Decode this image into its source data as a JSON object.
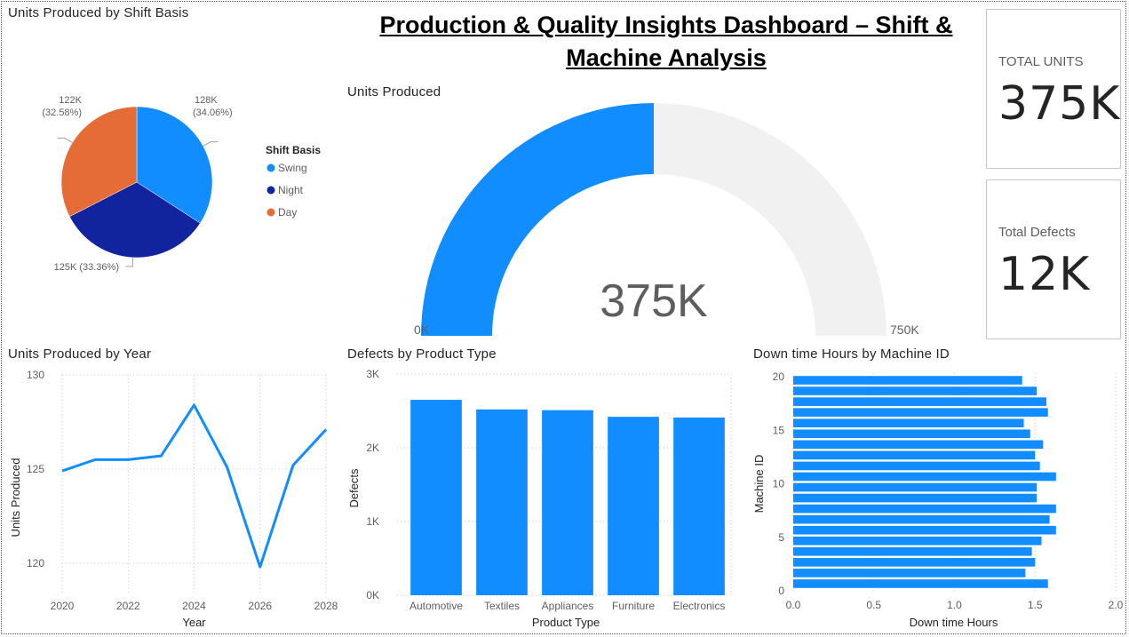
{
  "dashboard": {
    "title": "Production & Quality Insights Dashboard – Shift & Machine Analysis"
  },
  "colors": {
    "primary": "#118DFF",
    "dark_blue": "#12239E",
    "orange": "#E66C37",
    "gauge_track": "#F1F1F1"
  },
  "cards": {
    "total_units": {
      "label": "TOTAL UNITS",
      "value": "375K"
    },
    "total_defects": {
      "label": "Total Defects",
      "value": "12K"
    }
  },
  "visuals": {
    "pie_title": "Units Produced by Shift Basis",
    "gauge_title": "Units Produced",
    "line_title": "Units Produced by Year",
    "bar_title": "Defects by Product Type",
    "hbar_title": "Down time Hours by Machine ID"
  },
  "chart_data": [
    {
      "type": "pie",
      "title": "Units Produced by Shift Basis",
      "legend_title": "Shift Basis",
      "legend_position": "right",
      "slices": [
        {
          "name": "Swing",
          "value": 128,
          "label": "128K",
          "pct": "(34.06%)",
          "color": "#118DFF"
        },
        {
          "name": "Night",
          "value": 125,
          "label": "125K (33.36%)",
          "pct": "",
          "color": "#12239E"
        },
        {
          "name": "Day",
          "value": 122,
          "label": "122K",
          "pct": "(32.58%)",
          "color": "#E66C37"
        }
      ]
    },
    {
      "type": "gauge",
      "title": "Units Produced",
      "value": 375,
      "min": 0,
      "max": 750,
      "value_label": "375K",
      "min_label": "0K",
      "max_label": "750K"
    },
    {
      "type": "line",
      "title": "Units Produced by Year",
      "xlabel": "Year",
      "ylabel": "Units Produced",
      "x": [
        2020,
        2021,
        2022,
        2023,
        2024,
        2025,
        2026,
        2027,
        2028
      ],
      "values": [
        124.9,
        125.5,
        125.5,
        125.7,
        128.4,
        125.1,
        119.8,
        125.2,
        127.1
      ],
      "xlim": [
        2020,
        2028
      ],
      "ylim": [
        118.3,
        130
      ],
      "x_ticks": [
        "2020",
        "2022",
        "2024",
        "2026",
        "2028"
      ],
      "y_ticks": [
        "120",
        "125",
        "130"
      ],
      "grid": true
    },
    {
      "type": "bar",
      "title": "Defects by Product Type",
      "xlabel": "Product Type",
      "ylabel": "Defects",
      "categories": [
        "Automotive",
        "Textiles",
        "Appliances",
        "Furniture",
        "Electronics"
      ],
      "values": [
        2650,
        2520,
        2510,
        2420,
        2410
      ],
      "ylim": [
        0,
        3000
      ],
      "y_ticks": [
        "0K",
        "1K",
        "2K",
        "3K"
      ],
      "grid": true
    },
    {
      "type": "bar",
      "orientation": "horizontal",
      "title": "Down time Hours by Machine ID",
      "xlabel": "Down time Hours",
      "ylabel": "Machine ID",
      "categories": [
        1,
        2,
        3,
        4,
        5,
        6,
        7,
        8,
        9,
        10,
        11,
        12,
        13,
        14,
        15,
        16,
        17,
        18,
        19,
        20
      ],
      "values": [
        1.58,
        1.44,
        1.5,
        1.48,
        1.54,
        1.63,
        1.59,
        1.63,
        1.51,
        1.51,
        1.63,
        1.53,
        1.5,
        1.55,
        1.47,
        1.43,
        1.58,
        1.57,
        1.51,
        1.42
      ],
      "xlim": [
        0,
        2
      ],
      "ylim": [
        0,
        20
      ],
      "x_ticks": [
        "0.0",
        "0.5",
        "1.0",
        "1.5",
        "2.0"
      ],
      "y_ticks": [
        "0",
        "5",
        "10",
        "15",
        "20"
      ],
      "grid": true
    }
  ]
}
